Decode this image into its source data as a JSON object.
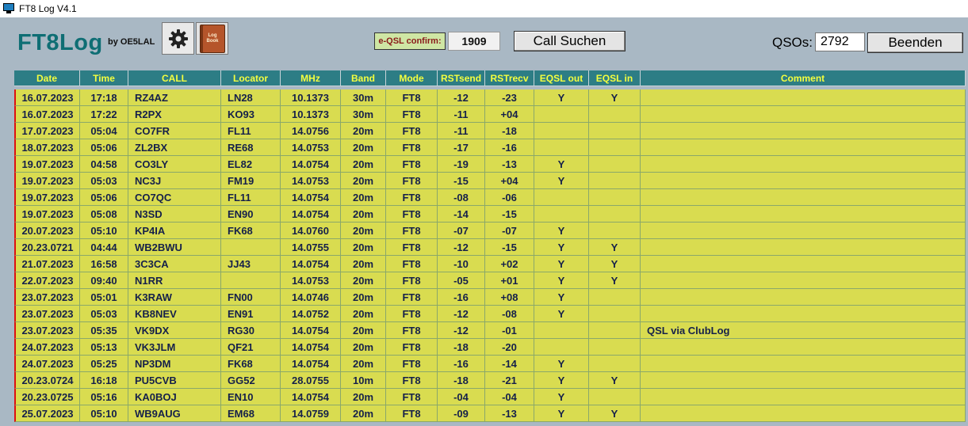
{
  "window": {
    "title": "FT8 Log V4.1"
  },
  "toolbar": {
    "logo": "FT8Log",
    "logo_by": "by OE5LAL",
    "book_label": "Log Book",
    "eqsl_label": "e-QSL confirm:",
    "eqsl_count": "1909",
    "call_button": "Call Suchen",
    "qsos_label": "QSOs:",
    "qsos_value": "2792",
    "end_button": "Beenden"
  },
  "colors": {
    "logo": "#0f6e74",
    "header_bg": "#2d7d85",
    "header_text": "#f4ff3e",
    "row_bg": "#d9dc50",
    "row_text": "#15204a",
    "divider": "#8d1d1d"
  },
  "table": {
    "headers": [
      "Date",
      "Time",
      "CALL",
      "Locator",
      "MHz",
      "Band",
      "Mode",
      "RSTsend",
      "RSTrecv",
      "EQSL out",
      "EQSL in",
      "Comment"
    ],
    "rows": [
      [
        "16.07.2023",
        "17:18",
        "RZ4AZ",
        "LN28",
        "10.1373",
        "30m",
        "FT8",
        "-12",
        "-23",
        "Y",
        "Y",
        ""
      ],
      [
        "16.07.2023",
        "17:22",
        "R2PX",
        "KO93",
        "10.1373",
        "30m",
        "FT8",
        "-11",
        "+04",
        "",
        "",
        ""
      ],
      [
        "17.07.2023",
        "05:04",
        "CO7FR",
        "FL11",
        "14.0756",
        "20m",
        "FT8",
        "-11",
        "-18",
        "",
        "",
        ""
      ],
      [
        "18.07.2023",
        "05:06",
        "ZL2BX",
        "RE68",
        "14.0753",
        "20m",
        "FT8",
        "-17",
        "-16",
        "",
        "",
        ""
      ],
      [
        "19.07.2023",
        "04:58",
        "CO3LY",
        "EL82",
        "14.0754",
        "20m",
        "FT8",
        "-19",
        "-13",
        "Y",
        "",
        ""
      ],
      [
        "19.07.2023",
        "05:03",
        "NC3J",
        "FM19",
        "14.0753",
        "20m",
        "FT8",
        "-15",
        "+04",
        "Y",
        "",
        ""
      ],
      [
        "19.07.2023",
        "05:06",
        "CO7QC",
        "FL11",
        "14.0754",
        "20m",
        "FT8",
        "-08",
        "-06",
        "",
        "",
        ""
      ],
      [
        "19.07.2023",
        "05:08",
        "N3SD",
        "EN90",
        "14.0754",
        "20m",
        "FT8",
        "-14",
        "-15",
        "",
        "",
        ""
      ],
      [
        "20.07.2023",
        "05:10",
        "KP4IA",
        "FK68",
        "14.0760",
        "20m",
        "FT8",
        "-07",
        "-07",
        "Y",
        "",
        ""
      ],
      [
        "20.23.0721",
        "04:44",
        "WB2BWU",
        "",
        "14.0755",
        "20m",
        "FT8",
        "-12",
        "-15",
        "Y",
        "Y",
        ""
      ],
      [
        "21.07.2023",
        "16:58",
        "3C3CA",
        "JJ43",
        "14.0754",
        "20m",
        "FT8",
        "-10",
        "+02",
        "Y",
        "Y",
        ""
      ],
      [
        "22.07.2023",
        "09:40",
        "N1RR",
        "",
        "14.0753",
        "20m",
        "FT8",
        "-05",
        "+01",
        "Y",
        "Y",
        ""
      ],
      [
        "23.07.2023",
        "05:01",
        "K3RAW",
        "FN00",
        "14.0746",
        "20m",
        "FT8",
        "-16",
        "+08",
        "Y",
        "",
        ""
      ],
      [
        "23.07.2023",
        "05:03",
        "KB8NEV",
        "EN91",
        "14.0752",
        "20m",
        "FT8",
        "-12",
        "-08",
        "Y",
        "",
        ""
      ],
      [
        "23.07.2023",
        "05:35",
        "VK9DX",
        "RG30",
        "14.0754",
        "20m",
        "FT8",
        "-12",
        "-01",
        "",
        "",
        "QSL via ClubLog"
      ],
      [
        "24.07.2023",
        "05:13",
        "VK3JLM",
        "QF21",
        "14.0754",
        "20m",
        "FT8",
        "-18",
        "-20",
        "",
        "",
        ""
      ],
      [
        "24.07.2023",
        "05:25",
        "NP3DM",
        "FK68",
        "14.0754",
        "20m",
        "FT8",
        "-16",
        "-14",
        "Y",
        "",
        ""
      ],
      [
        "20.23.0724",
        "16:18",
        "PU5CVB",
        "GG52",
        "28.0755",
        "10m",
        "FT8",
        "-18",
        "-21",
        "Y",
        "Y",
        ""
      ],
      [
        "20.23.0725",
        "05:16",
        "KA0BOJ",
        "EN10",
        "14.0754",
        "20m",
        "FT8",
        "-04",
        "-04",
        "Y",
        "",
        ""
      ],
      [
        "25.07.2023",
        "05:10",
        "WB9AUG",
        "EM68",
        "14.0759",
        "20m",
        "FT8",
        "-09",
        "-13",
        "Y",
        "Y",
        ""
      ]
    ]
  }
}
